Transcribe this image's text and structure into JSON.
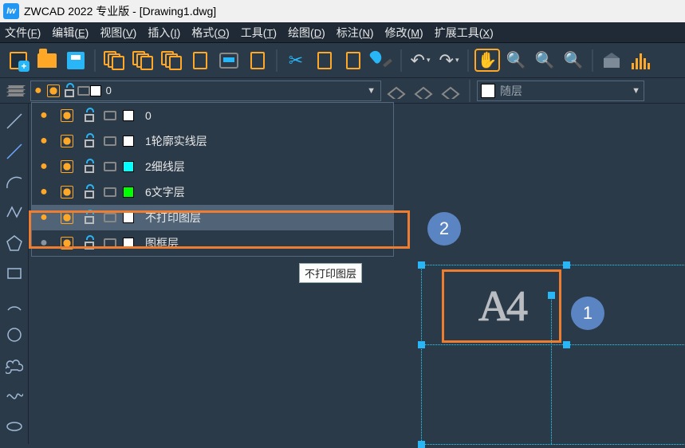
{
  "title": "ZWCAD 2022 专业版 - [Drawing1.dwg]",
  "menus": [
    {
      "label": "文件",
      "key": "F"
    },
    {
      "label": "编辑",
      "key": "E"
    },
    {
      "label": "视图",
      "key": "V"
    },
    {
      "label": "插入",
      "key": "I"
    },
    {
      "label": "格式",
      "key": "O"
    },
    {
      "label": "工具",
      "key": "T"
    },
    {
      "label": "绘图",
      "key": "D"
    },
    {
      "label": "标注",
      "key": "N"
    },
    {
      "label": "修改",
      "key": "M"
    },
    {
      "label": "扩展工具",
      "key": "X"
    }
  ],
  "layer_selector": {
    "current_name": "0",
    "current_swatch": "#ffffff",
    "items": [
      {
        "name": "0",
        "swatch": "#ffffff",
        "on": true
      },
      {
        "name": "1轮廓实线层",
        "swatch": "#ffffff",
        "on": true
      },
      {
        "name": "2细线层",
        "swatch": "#00ffff",
        "on": true
      },
      {
        "name": "6文字层",
        "swatch": "#00ff00",
        "on": true
      },
      {
        "name": "不打印图层",
        "swatch": "#ffffff",
        "on": true,
        "highlight": true
      },
      {
        "name": "图框层",
        "swatch": "#ffffff",
        "on": false
      }
    ]
  },
  "tooltip": "不打印图层",
  "second_selector": "随层",
  "callouts": {
    "one": "1",
    "two": "2"
  },
  "a4_label": "A4"
}
